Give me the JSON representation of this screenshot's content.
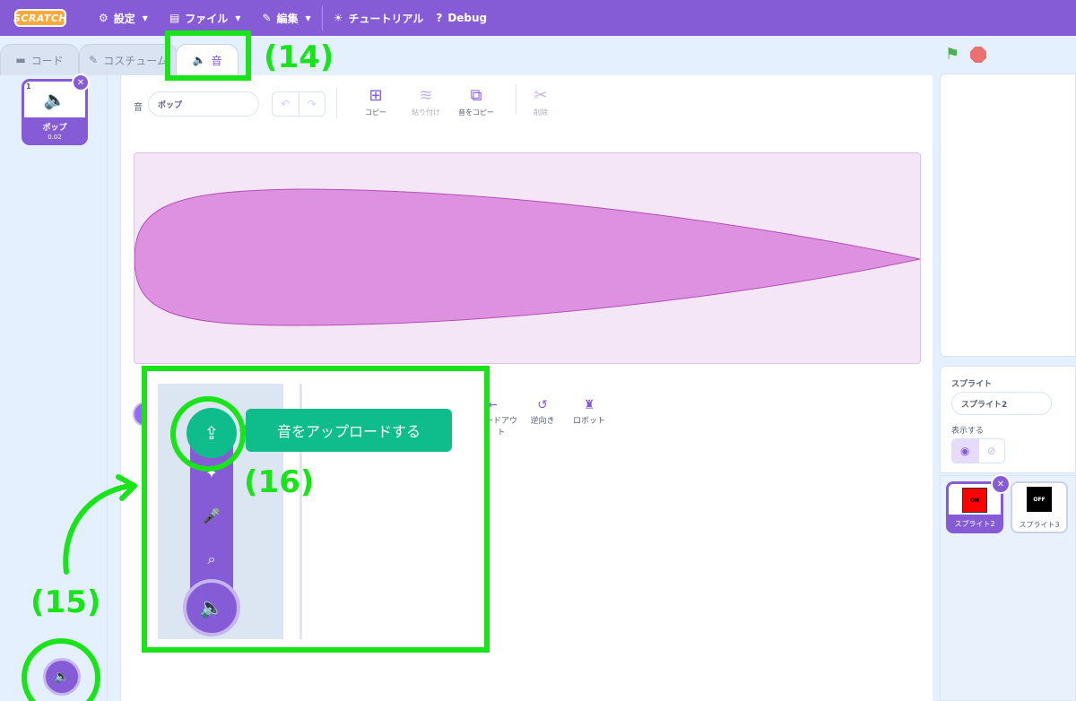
{
  "menubar": {
    "logo": "SCRATCH",
    "settings": "設定",
    "file": "ファイル",
    "edit": "編集",
    "tutorials": "チュートリアル",
    "debug": "Debug"
  },
  "tabs": {
    "code": "コード",
    "costumes": "コスチューム",
    "sounds": "音"
  },
  "sound_list": [
    {
      "index": "1",
      "name": "ポップ",
      "duration": "0.02"
    }
  ],
  "sound_editor": {
    "name_label": "音",
    "name_value": "ポップ",
    "tools": {
      "copy": "コピー",
      "paste": "貼り付け",
      "copy_to_new": "音をコピー",
      "delete": "削除"
    },
    "effects": {
      "fade_out_partial_1": "ードアウ",
      "fade_out_partial_2": "ト",
      "reverse": "逆向き",
      "robot": "ロボット"
    }
  },
  "add_sound_menu": {
    "tooltip": "音をアップロードする",
    "items": [
      "upload-icon",
      "surprise-icon",
      "microphone-icon",
      "search-icon"
    ]
  },
  "sprite_pane": {
    "section_label": "スプライト",
    "sprite_name": "スプライト2",
    "show_label": "表示する",
    "sprites": [
      {
        "name": "スプライト2",
        "thumb_text": "ON",
        "thumb_color": "#ff0000",
        "selected": true
      },
      {
        "name": "スプライト3",
        "thumb_text": "OFF",
        "thumb_color": "#000000",
        "selected": false
      }
    ]
  },
  "annotations": {
    "a14": "(14)",
    "a15": "(15)",
    "a16": "(16)"
  },
  "colors": {
    "accent": "#855cd6",
    "highlight": "#19e319",
    "upload_green": "#0fbd8c"
  }
}
